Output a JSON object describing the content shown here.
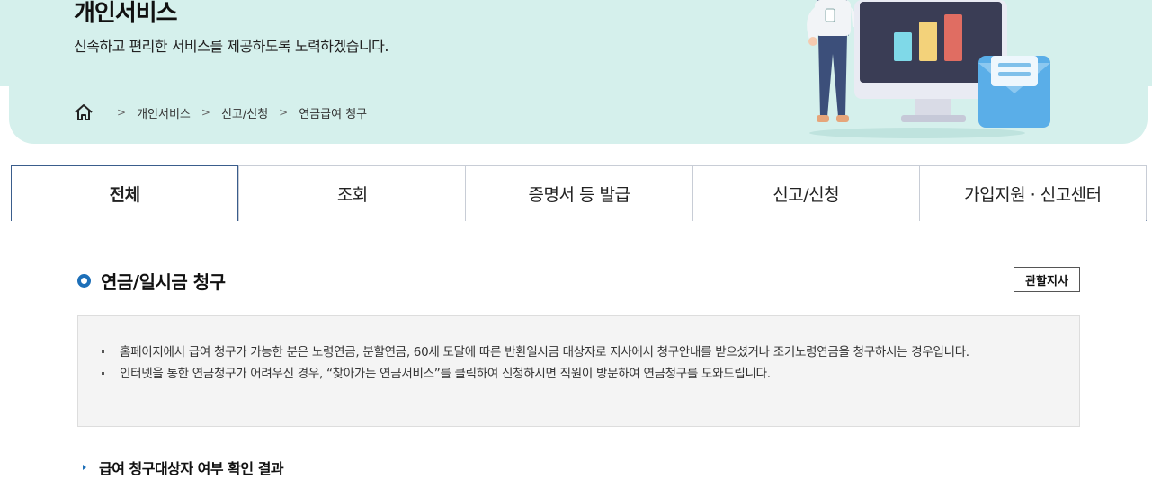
{
  "hero": {
    "title": "개인서비스",
    "subtitle": "신속하고 편리한 서비스를 제공하도록 노력하겠습니다."
  },
  "breadcrumb": {
    "home_icon": "home-icon",
    "items": [
      "개인서비스",
      "신고/신청",
      "연금급여 청구"
    ],
    "separator": ">"
  },
  "tabs": [
    {
      "label": "전체",
      "active": true
    },
    {
      "label": "조회",
      "active": false
    },
    {
      "label": "증명서 등 발급",
      "active": false
    },
    {
      "label": "신고/신청",
      "active": false
    },
    {
      "label": "가입지원 · 신고센터",
      "active": false
    }
  ],
  "section": {
    "title": "연금/일시금 청구",
    "office_button": "관할지사",
    "notices": [
      "홈페이지에서 급여 청구가 가능한 분은 노령연금, 분할연금, 60세 도달에 따른 반환일시금 대상자로 지사에서 청구안내를 받으셨거나 조기노령연금을 청구하시는 경우입니다.",
      "인터넷을 통한 연금청구가 어려우신 경우, “찾아가는 연금서비스”를 클릭하여 신청하시면 직원이 방문하여 연금청구를 도와드립니다."
    ],
    "subtitle": "급여 청구대상자 여부 확인 결과"
  },
  "colors": {
    "hero_bg": "#d5f0ec",
    "accent_blue": "#1d6fb8",
    "tab_active_border": "#3a5d8c",
    "notice_bg": "#f4f4f4"
  }
}
